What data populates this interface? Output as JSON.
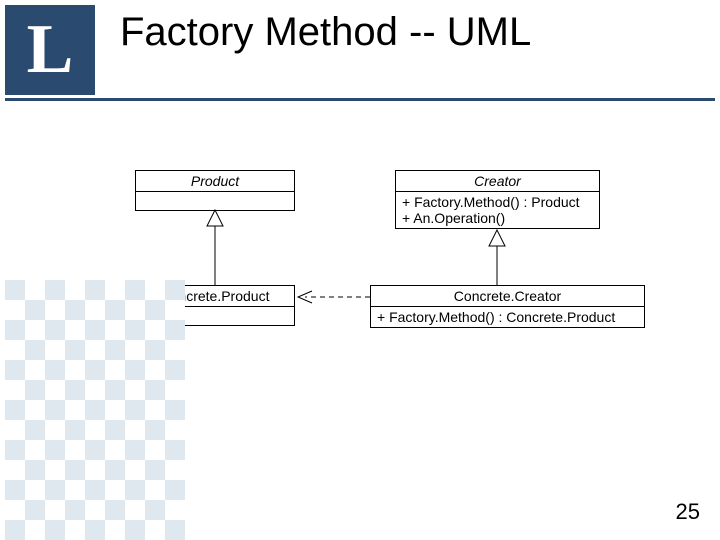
{
  "logo_letter": "L",
  "title": "Factory Method -- UML",
  "page_number": "25",
  "classes": {
    "product": {
      "name": "Product"
    },
    "creator": {
      "name": "Creator",
      "op1": "+ Factory.Method() : Product",
      "op2": "+ An.Operation()"
    },
    "concrete_product": {
      "name": "Concrete.Product"
    },
    "concrete_creator": {
      "name": "Concrete.Creator",
      "op1": "+ Factory.Method() : Concrete.Product"
    }
  }
}
